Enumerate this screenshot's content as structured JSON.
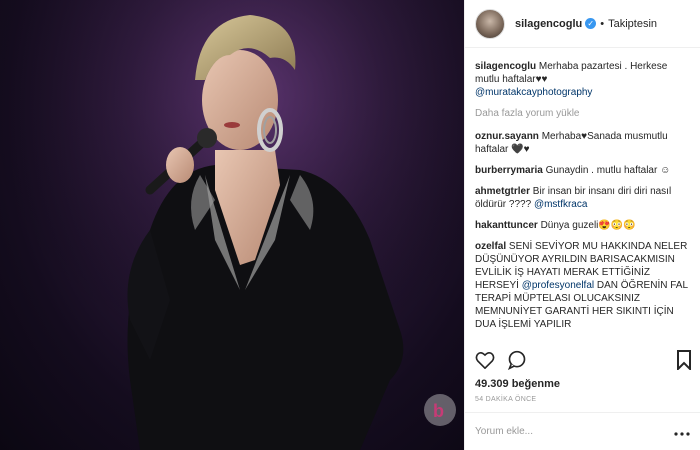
{
  "post": {
    "username": "silagencoglu",
    "verified_icon": "verified-badge-icon",
    "follow_status": "Takiptesin",
    "caption": {
      "user": "silagencoglu",
      "text": "Merhaba pazartesi . Herkese mutlu haftalar♥♥",
      "mention": "@muratakcayphotography"
    },
    "load_more": "Daha fazla yorum yükle",
    "comments": [
      {
        "user": "oznur.sayann",
        "text": "Merhaba♥Sanada musmutlu haftalar 🖤♥"
      },
      {
        "user": "burberrymaria",
        "text": "Gunaydin . mutlu haftalar ☺"
      },
      {
        "user": "ahmetgtrler",
        "text": "Bir insan bir insanı diri diri nasıl öldürür ???? ",
        "mention": "@mstfkraca"
      },
      {
        "user": "hakanttuncer",
        "text": "Dünya guzeli😍😳😳"
      },
      {
        "user": "ozelfal",
        "text": "SENİ SEVİYOR MU HAKKINDA NELER DÜŞÜNÜYOR AYRILDIN BARISACAKMISIN EVLİLİK İŞ HAYATI MERAK ETTİĞİNİZ HERSEYİ ",
        "mention": "@profesyonelfal",
        "text2": " DAN ÖĞRENİN FAL TERAPİ MÜPTELASI OLUCAKSINIZ MEMNUNİYET GARANTİ HER SIKINTI İÇİN DUA İŞLEMİ YAPILIR"
      }
    ],
    "likes": "49.309 beğenme",
    "time_ago": "54 DAKİKA ÖNCE",
    "add_comment_placeholder": "Yorum ekle...",
    "icons": {
      "like": "heart-icon",
      "comment": "comment-icon",
      "save": "bookmark-icon",
      "more": "more-options-icon"
    },
    "colors": {
      "mention": "#003569",
      "verified": "#3897f0",
      "muted": "#999999"
    }
  }
}
